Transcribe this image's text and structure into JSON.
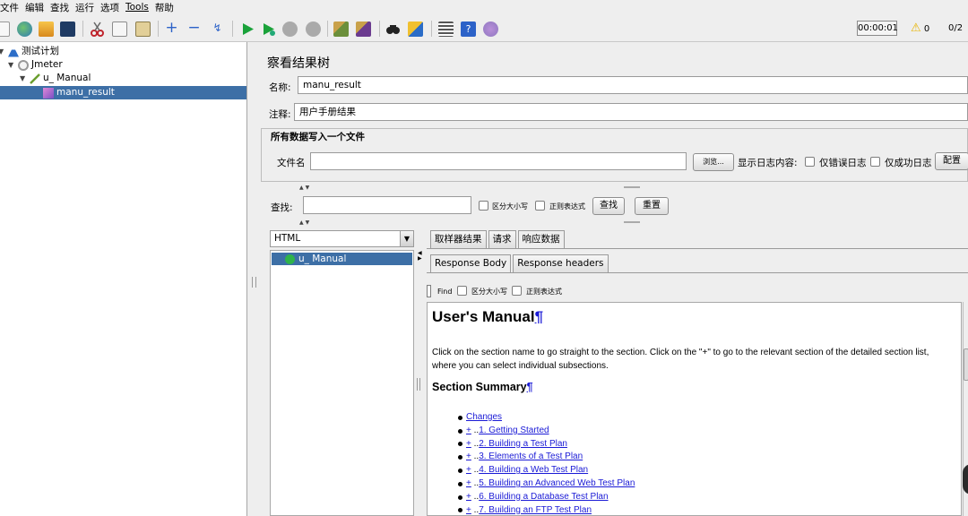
{
  "menu": [
    "文件",
    "编辑",
    "查找",
    "运行",
    "选项",
    "Tools",
    "帮助"
  ],
  "toolbar_icons": [
    "new-icon",
    "templates-icon",
    "open-icon",
    "save-icon",
    "cut-icon",
    "copy-icon",
    "paste-icon",
    "expand-icon",
    "collapse-icon",
    "toggle-icon",
    "start-icon",
    "start-no-pause-icon",
    "stop-icon",
    "shutdown-icon",
    "clear-icon",
    "clear-all-icon",
    "search-icon",
    "reset-search-icon",
    "function-helper-icon",
    "help-icon",
    "remote-icon"
  ],
  "status": {
    "timer": "00:00:01",
    "warnings": "0",
    "threads": "0/2"
  },
  "tree": [
    {
      "label": "测试计划",
      "icon": "test-plan-icon",
      "level": 0,
      "expanded": true
    },
    {
      "label": "Jmeter",
      "icon": "thread-group-icon",
      "level": 1,
      "expanded": true
    },
    {
      "label": "u_ Manual",
      "icon": "sampler-icon",
      "level": 2,
      "expanded": true
    },
    {
      "label": "manu_result",
      "icon": "listener-icon",
      "level": 3,
      "selected": true
    }
  ],
  "panel": {
    "title": "察看结果树",
    "name_label": "名称:",
    "name_value": "manu_result",
    "comment_label": "注释:",
    "comment_value": "用户手册结果",
    "file_section": "所有数据写入一个文件",
    "filename_label": "文件名",
    "filename_value": "",
    "browse_button": "浏览...",
    "log_content_label": "显示日志内容:",
    "errors_only": "仅错误日志",
    "success_only": "仅成功日志",
    "config_button": "配置",
    "search_label": "查找:",
    "search_value": "",
    "case_sensitive": "区分大小写",
    "regex": "正则表达式",
    "find_button": "查找",
    "reset_button": "重置"
  },
  "renderer": {
    "selected": "HTML",
    "results": [
      "u_ Manual"
    ]
  },
  "tabs": [
    "取样器结果",
    "请求",
    "响应数据"
  ],
  "active_tab": "响应数据",
  "subtabs": [
    "Response Body",
    "Response headers"
  ],
  "active_subtab": "Response Body",
  "findbar": {
    "find": "Find",
    "case_sensitive": "区分大小写",
    "regex": "正则表达式"
  },
  "document": {
    "title": "User's Manual",
    "pilcrow": "¶",
    "intro": "Click on the section name to go straight to the section. Click on the \"+\" to go to the relevant section of the detailed section list, where you can select individual subsections.",
    "section_heading": "Section Summary",
    "items": [
      {
        "plus": "",
        "text": "Changes"
      },
      {
        "plus": "+",
        "text": "1. Getting Started"
      },
      {
        "plus": "+",
        "text": "2. Building a Test Plan"
      },
      {
        "plus": "+",
        "text": "3. Elements of a Test Plan"
      },
      {
        "plus": "+",
        "text": "4. Building a Web Test Plan"
      },
      {
        "plus": "+",
        "text": "5. Building an Advanced Web Test Plan"
      },
      {
        "plus": "+",
        "text": "6. Building a Database Test Plan"
      },
      {
        "plus": "+",
        "text": "7. Building an FTP Test Plan"
      }
    ]
  }
}
